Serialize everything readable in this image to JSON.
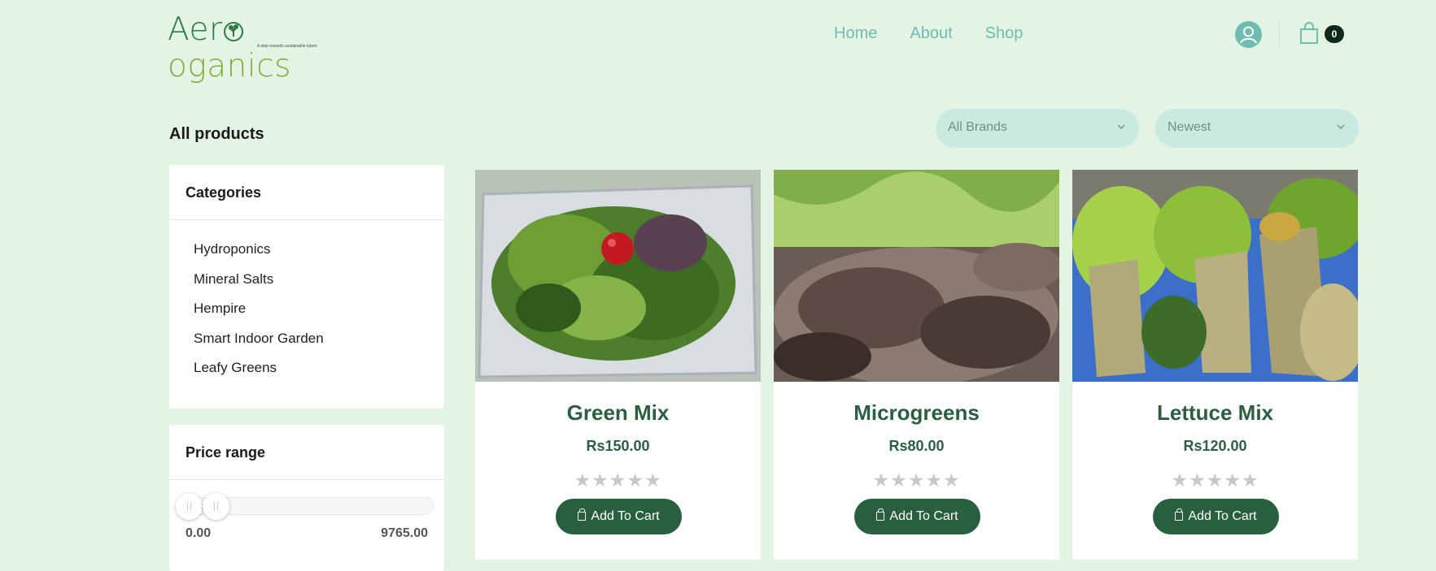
{
  "brand": {
    "name_part1": "Aer",
    "name_part2": "oganics",
    "tagline": "A step towards sustainable future"
  },
  "nav": {
    "items": [
      "Home",
      "About",
      "Shop"
    ]
  },
  "cart": {
    "count": "0"
  },
  "page": {
    "title": "All products"
  },
  "filters": {
    "brands": "All Brands",
    "sort": "Newest"
  },
  "categories": {
    "title": "Categories",
    "items": [
      "Hydroponics",
      "Mineral Salts",
      "Hempire",
      "Smart Indoor Garden",
      "Leafy Greens"
    ]
  },
  "price_range": {
    "title": "Price range",
    "min": "0.00",
    "max": "9765.00",
    "selected_fraction": [
      0.0,
      0.1
    ]
  },
  "products": [
    {
      "name": "Green Mix",
      "price": "Rs150.00",
      "rating": 0,
      "button": "Add To Cart"
    },
    {
      "name": "Microgreens",
      "price": "Rs80.00",
      "rating": 0,
      "button": "Add To Cart"
    },
    {
      "name": "Lettuce Mix",
      "price": "Rs120.00",
      "rating": 0,
      "button": "Add To Cart"
    }
  ],
  "colors": {
    "background": "#e3f4e4",
    "accent": "#275f3f",
    "nav": "#6ebdb0",
    "select_bg": "#c9e9e1"
  },
  "icons": [
    "user-icon",
    "cart-icon",
    "chevron-down-icon",
    "bag-icon",
    "star-icon"
  ]
}
